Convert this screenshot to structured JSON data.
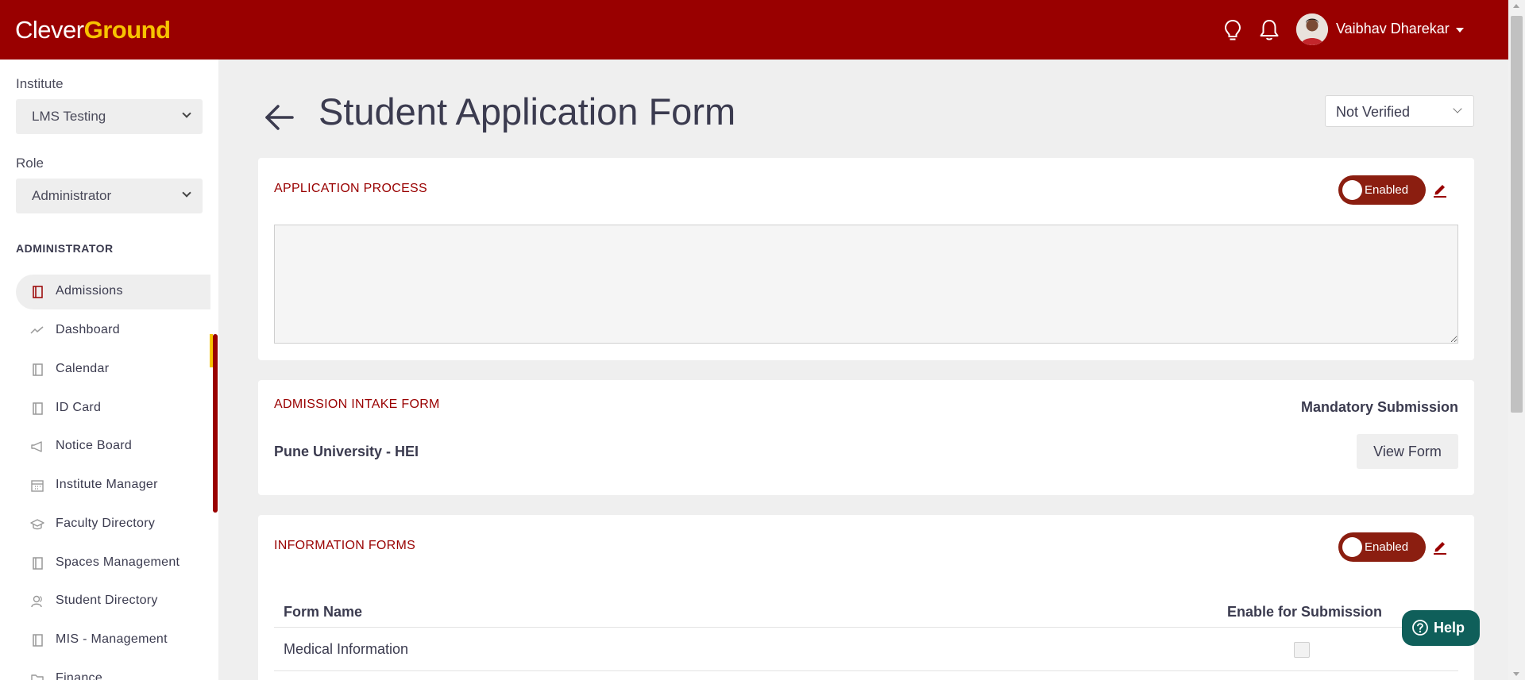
{
  "header": {
    "logo_part1": "Clever",
    "logo_part2": "Ground",
    "user_name": "Vaibhav Dharekar",
    "icons": [
      "lightbulb-icon",
      "bell-icon"
    ]
  },
  "sidebar": {
    "institute_label": "Institute",
    "institute_value": "LMS Testing",
    "role_label": "Role",
    "role_value": "Administrator",
    "section_heading": "ADMINISTRATOR",
    "items": [
      {
        "label": "Admissions",
        "icon": "book-icon",
        "active": true
      },
      {
        "label": "Dashboard",
        "icon": "trend-icon"
      },
      {
        "label": "Calendar",
        "icon": "book-icon"
      },
      {
        "label": "ID Card",
        "icon": "book-icon"
      },
      {
        "label": "Notice Board",
        "icon": "megaphone-icon"
      },
      {
        "label": "Institute Manager",
        "icon": "calendar-icon"
      },
      {
        "label": "Faculty Directory",
        "icon": "graduation-icon"
      },
      {
        "label": "Spaces Management",
        "icon": "book-icon"
      },
      {
        "label": "Student Directory",
        "icon": "users-icon"
      },
      {
        "label": "MIS - Management",
        "icon": "book-icon"
      },
      {
        "label": "Finance",
        "icon": "folder-icon"
      }
    ]
  },
  "main": {
    "title": "Student Application Form",
    "status_value": "Not Verified",
    "application_process": {
      "title": "APPLICATION PROCESS",
      "toggle_label": "Enabled",
      "textarea_value": ""
    },
    "admission_intake": {
      "title": "ADMISSION INTAKE FORM",
      "mandatory_label": "Mandatory Submission",
      "form_name": "Pune University - HEI",
      "view_button": "View Form"
    },
    "information_forms": {
      "title": "INFORMATION FORMS",
      "toggle_label": "Enabled",
      "col_form_name": "Form Name",
      "col_enable": "Enable for Submission",
      "rows": [
        {
          "name": "Medical Information",
          "enabled": false
        }
      ]
    }
  },
  "help": {
    "label": "Help"
  },
  "colors": {
    "brand_red": "#990000",
    "brand_yellow": "#f7c300",
    "toggle_bg": "#8b1e10",
    "help_bg": "#0f5f5a"
  }
}
